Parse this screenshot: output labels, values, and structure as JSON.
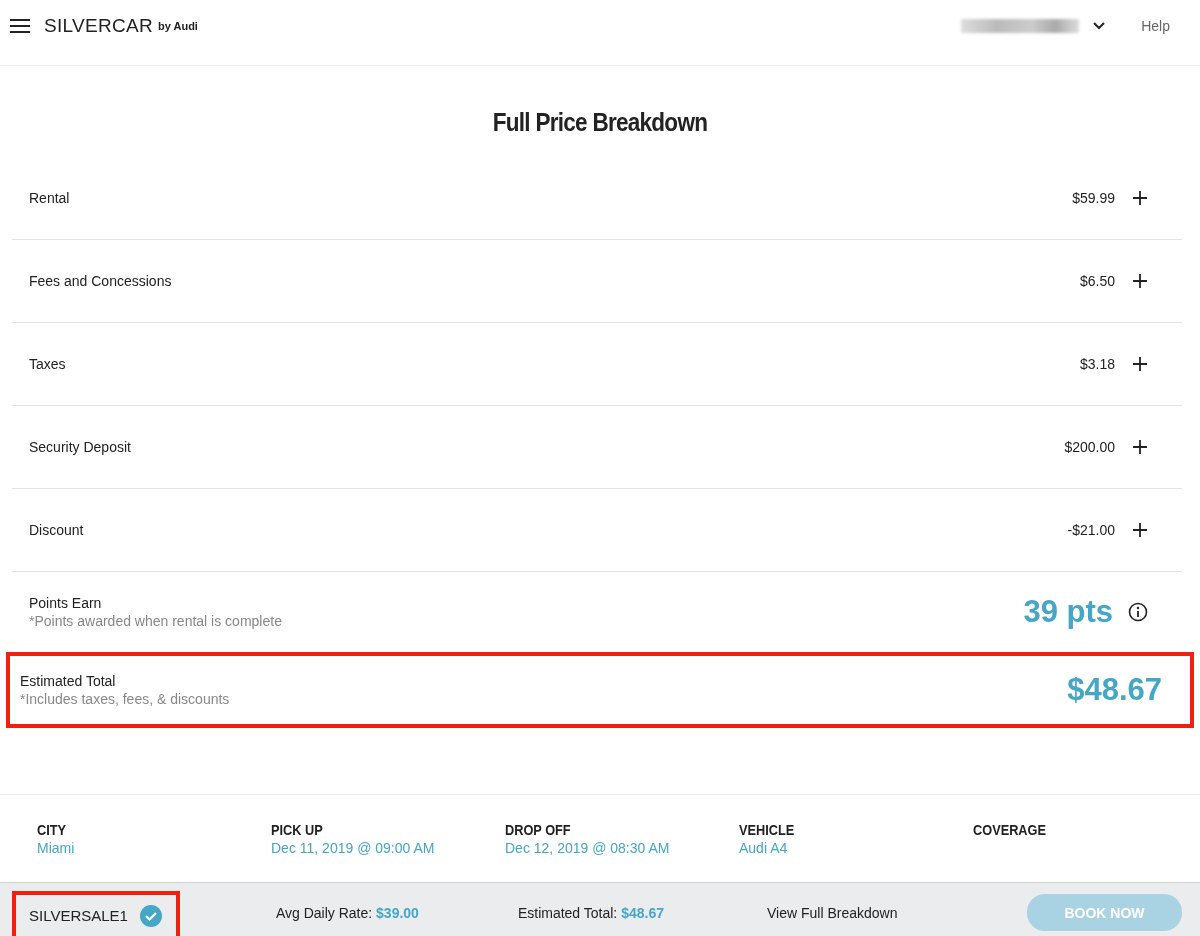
{
  "header": {
    "brand": "SILVERCAR",
    "brand_sub": "by Audi",
    "help": "Help"
  },
  "title": "Full Price Breakdown",
  "line_items": [
    {
      "label": "Rental",
      "amount": "$59.99"
    },
    {
      "label": "Fees and Concessions",
      "amount": "$6.50"
    },
    {
      "label": "Taxes",
      "amount": "$3.18"
    },
    {
      "label": "Security Deposit",
      "amount": "$200.00"
    },
    {
      "label": "Discount",
      "amount": "-$21.00"
    }
  ],
  "points": {
    "label": "Points Earn",
    "note": "*Points awarded when rental is complete",
    "value": "39 pts"
  },
  "total": {
    "label": "Estimated Total",
    "note": "*Includes taxes, fees, & discounts",
    "value": "$48.67",
    "highlighted": true
  },
  "summary": [
    {
      "heading": "CITY",
      "value": "Miami"
    },
    {
      "heading": "PICK UP",
      "value": "Dec 11, 2019 @ 09:00 AM"
    },
    {
      "heading": "DROP OFF",
      "value": "Dec 12, 2019 @ 08:30 AM"
    },
    {
      "heading": "VEHICLE",
      "value": "Audi A4"
    },
    {
      "heading": "COVERAGE"
    }
  ],
  "bottom_bar": {
    "promo": {
      "code": "SILVERSALE1",
      "applied": true,
      "highlighted": true
    },
    "avg_rate": {
      "label": "Avg Daily Rate:",
      "value": "$39.00"
    },
    "estimated": {
      "label": "Estimated Total:",
      "value": "$48.67"
    },
    "breakdown_link": "View Full Breakdown",
    "book": {
      "label": "BOOK NOW",
      "disabled": true
    }
  }
}
